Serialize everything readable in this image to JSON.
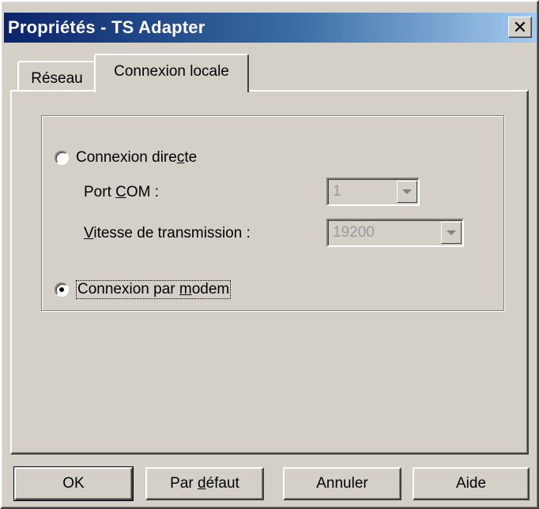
{
  "window": {
    "title": "Propriétés - TS Adapter",
    "close_glyph": "✕"
  },
  "tabs": [
    {
      "label": "Réseau",
      "active": false
    },
    {
      "label": "Connexion locale",
      "active": true
    }
  ],
  "connection": {
    "direct": {
      "label_pre": "Connexion dire",
      "label_accel": "c",
      "label_post": "te",
      "checked": false
    },
    "port_com": {
      "label_pre": "Port ",
      "label_accel": "C",
      "label_post": "OM :",
      "value": "1",
      "enabled": false
    },
    "baud": {
      "label_pre": "",
      "label_accel": "V",
      "label_post": "itesse de transmission :",
      "value": "19200",
      "enabled": false
    },
    "modem": {
      "label_pre": "Connexion par ",
      "label_accel": "m",
      "label_post": "odem",
      "checked": true
    }
  },
  "buttons": {
    "ok": "OK",
    "default_pre": "Par ",
    "default_accel": "d",
    "default_post": "éfaut",
    "cancel": "Annuler",
    "help": "Aide"
  },
  "colors": {
    "titlebar_start": "#0a246a",
    "titlebar_end": "#a6caf0",
    "face": "#d4d0c8",
    "disabled_text": "#9a9a9a"
  }
}
